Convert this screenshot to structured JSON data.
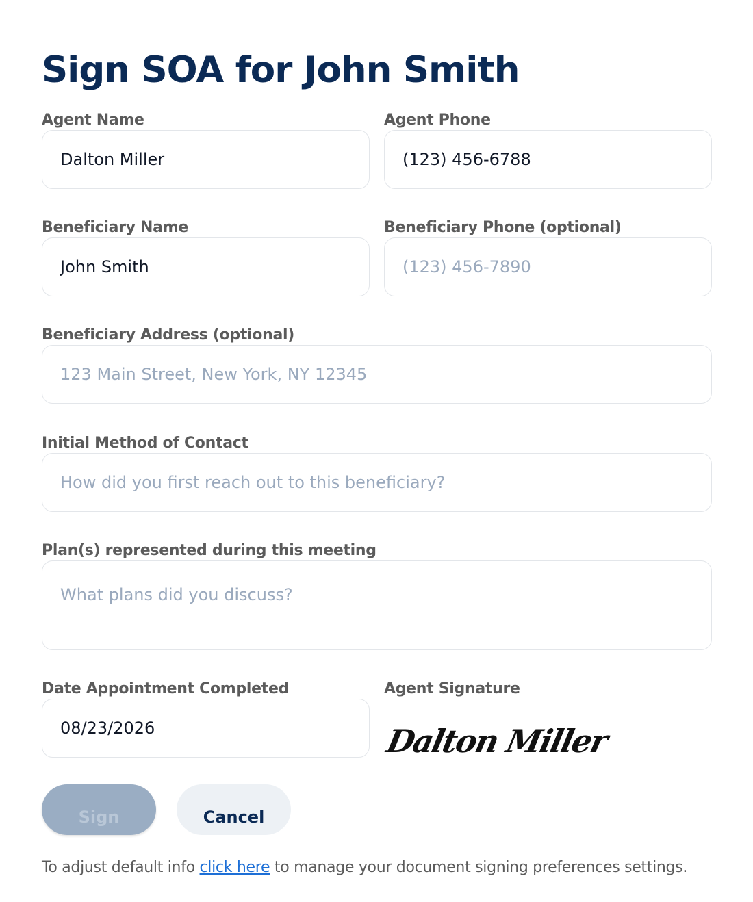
{
  "form": {
    "title": "Sign SOA for John Smith",
    "agent_name": {
      "label": "Agent Name",
      "value": "Dalton Miller",
      "placeholder": ""
    },
    "agent_phone": {
      "label": "Agent Phone",
      "value": "(123) 456-6788",
      "placeholder": ""
    },
    "beneficiary_name": {
      "label": "Beneficiary Name",
      "value": "John Smith",
      "placeholder": ""
    },
    "beneficiary_phone": {
      "label": "Beneficiary Phone (optional)",
      "value": "",
      "placeholder": "(123) 456-7890"
    },
    "beneficiary_address": {
      "label": "Beneficiary Address (optional)",
      "value": "",
      "placeholder": "123 Main Street, New York, NY 12345"
    },
    "initial_contact": {
      "label": "Initial Method of Contact",
      "value": "",
      "placeholder": "How did you first reach out to this beneficiary?"
    },
    "plans": {
      "label": "Plan(s) represented during this meeting",
      "value": "",
      "placeholder": "What plans did you discuss?"
    },
    "date_completed": {
      "label": "Date Appointment Completed",
      "value": "08/23/2026",
      "placeholder": ""
    },
    "agent_signature": {
      "label": "Agent Signature",
      "value": "Dalton Miller"
    }
  },
  "actions": {
    "sign_label": "Sign",
    "cancel_label": "Cancel"
  },
  "footer": {
    "text_before": "To adjust default info ",
    "link_text": "click here",
    "text_after": " to manage your document signing preferences settings."
  },
  "colors": {
    "title": "#0b2a55",
    "label": "#5b5b5b",
    "placeholder": "#9aa9bd",
    "sign_button_bg": "#9aadc3",
    "cancel_button_bg": "#edf1f5",
    "link": "#1d6fd6"
  }
}
